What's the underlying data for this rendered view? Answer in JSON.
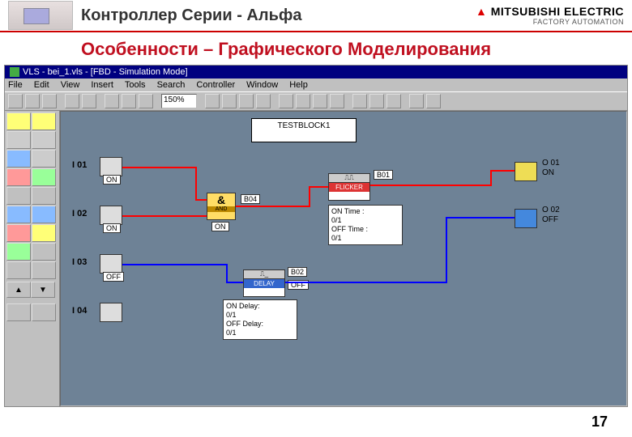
{
  "header": {
    "title": "Контроллер Серии - Альфа",
    "brand": "MITSUBISHI ELECTRIC",
    "brand_sub": "FACTORY AUTOMATION"
  },
  "subtitle": "Особенности – Графического Моделирования",
  "window": {
    "title": "VLS - bei_1.vls - [FBD - Simulation Mode]",
    "menus": [
      "File",
      "Edit",
      "View",
      "Insert",
      "Tools",
      "Search",
      "Controller",
      "Window",
      "Help"
    ],
    "zoom": "150%"
  },
  "canvas": {
    "testblock": "TESTBLOCK1",
    "inputs": [
      {
        "id": "I01",
        "label": "I 01",
        "state": "ON"
      },
      {
        "id": "I02",
        "label": "I 02",
        "state": "ON"
      },
      {
        "id": "I03",
        "label": "I 03",
        "state": "OFF"
      },
      {
        "id": "I04",
        "label": "I 04",
        "state": ""
      }
    ],
    "outputs": [
      {
        "id": "O01",
        "label": "O 01",
        "state": "ON"
      },
      {
        "id": "O02",
        "label": "O 02",
        "state": "OFF"
      }
    ],
    "blocks": {
      "and": {
        "id": "B04",
        "label": "B04",
        "type": "AND",
        "state": "ON"
      },
      "flicker": {
        "id": "B01",
        "label": "B01",
        "type": "FLICKER",
        "info": "ON Time :\n0/1\nOFF Time :\n0/1"
      },
      "delay": {
        "id": "B02",
        "label": "B02",
        "type": "DELAY",
        "state": "OFF",
        "info": "ON Delay:\n0/1\nOFF Delay:\n0/1"
      }
    }
  },
  "page": "17"
}
